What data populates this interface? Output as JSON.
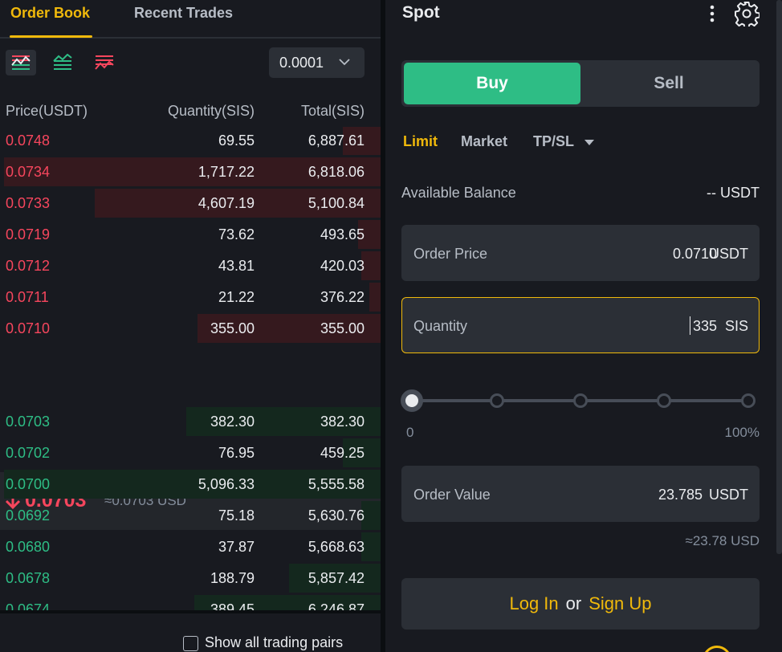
{
  "orderbook": {
    "tabs": [
      {
        "label": "Order Book",
        "active": true
      },
      {
        "label": "Recent Trades",
        "active": false
      }
    ],
    "precision": "0.0001",
    "columns": {
      "price": "Price(USDT)",
      "quantity": "Quantity(SIS)",
      "total": "Total(SIS)"
    },
    "asks": [
      {
        "price": "0.0748",
        "quantity": "69.55",
        "total": "6,887.61",
        "depth": 0.1
      },
      {
        "price": "0.0734",
        "quantity": "1,717.22",
        "total": "6,818.06",
        "depth": 0.99
      },
      {
        "price": "0.0733",
        "quantity": "4,607.19",
        "total": "5,100.84",
        "depth": 0.75
      },
      {
        "price": "0.0719",
        "quantity": "73.62",
        "total": "493.65",
        "depth": 0.06
      },
      {
        "price": "0.0712",
        "quantity": "43.81",
        "total": "420.03",
        "depth": 0.05
      },
      {
        "price": "0.0711",
        "quantity": "21.22",
        "total": "376.22",
        "depth": 0.03
      },
      {
        "price": "0.0710",
        "quantity": "355.00",
        "total": "355.00",
        "depth": 0.48
      }
    ],
    "mid": {
      "price": "0.0703",
      "usd": "≈0.0703 USD",
      "direction": "down"
    },
    "bids": [
      {
        "price": "0.0703",
        "quantity": "382.30",
        "total": "382.30",
        "depth": 0.51
      },
      {
        "price": "0.0702",
        "quantity": "76.95",
        "total": "459.25",
        "depth": 0.1
      },
      {
        "price": "0.0700",
        "quantity": "5,096.33",
        "total": "5,555.58",
        "depth": 0.99
      },
      {
        "price": "0.0692",
        "quantity": "75.18",
        "total": "5,630.76",
        "depth": 0.05
      },
      {
        "price": "0.0680",
        "quantity": "37.87",
        "total": "5,668.63",
        "depth": 0.05
      },
      {
        "price": "0.0678",
        "quantity": "188.79",
        "total": "5,857.42",
        "depth": 0.24
      },
      {
        "price": "0.0674",
        "quantity": "389.45",
        "total": "6,246.87",
        "depth": 0.49
      }
    ],
    "show_all_label": "Show all trading pairs",
    "colors": {
      "ask": "#f6465d",
      "bid": "#2ebd85",
      "accent": "#f0b90b"
    }
  },
  "trade": {
    "title": "Spot",
    "buy_label": "Buy",
    "sell_label": "Sell",
    "order_types": [
      "Limit",
      "Market",
      "TP/SL"
    ],
    "active_order_type": "Limit",
    "available_label": "Available Balance",
    "available_value": "-- USDT",
    "order_price": {
      "label": "Order Price",
      "value": "0.0710",
      "unit": "USDT"
    },
    "quantity": {
      "label": "Quantity",
      "value": "335",
      "unit": "SIS"
    },
    "slider": {
      "min_label": "0",
      "max_label": "100%",
      "value": 0
    },
    "order_value": {
      "label": "Order Value",
      "value": "23.785",
      "unit": "USDT"
    },
    "approx_usd": "≈23.78 USD",
    "login": {
      "login_label": "Log In",
      "or_label": "or",
      "signup_label": "Sign Up"
    }
  }
}
